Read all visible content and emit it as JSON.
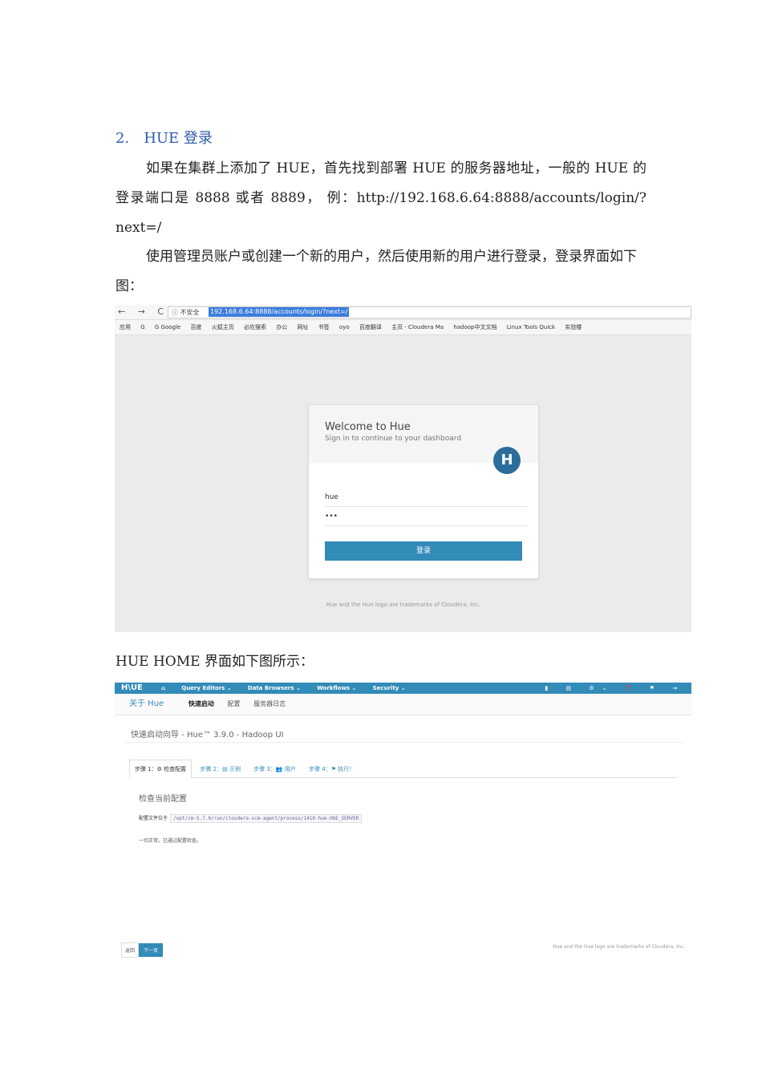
{
  "section": {
    "number": "2.",
    "title": "HUE 登录"
  },
  "paragraphs": {
    "p1": "如果在集群上添加了 HUE，首先找到部署 HUE 的服务器地址，一般的 HUE 的登录端口是 8888 或者 8889， 例：http://192.168.6.64:8888/accounts/login/?next=/",
    "p2": "使用管理员账户或创建一个新的用户，然后使用新的用户进行登录，登录界面如下图：",
    "p3": "HUE HOME 界面如下图所示："
  },
  "login_shot": {
    "nav": "← → C ⌂",
    "insecure": "ⓘ 不安全",
    "url": "192.168.6.64:8888/accounts/login/?next=/",
    "bookmarks": [
      "应用",
      "G",
      "G Google",
      "百度",
      "火狐主页",
      "必应搜索",
      "办公",
      "网址",
      "书签",
      "oyo",
      "百度翻译",
      "主页 - Cloudera Ma",
      "hadoop中文文档",
      "Linux Tools Quick",
      "实验楼"
    ],
    "title": "Welcome to Hue",
    "subtitle": "Sign in to continue to your dashboard",
    "logo": "H",
    "username": "hue",
    "password": "•••",
    "button": "登录",
    "footer": "Hue and the Hue logo are trademarks of Cloudera, Inc."
  },
  "home_shot": {
    "brand": "H\\UE",
    "menus": [
      "⌂",
      "Query Editors ⌄",
      "Data Browsers ⌄",
      "Workflows ⌄",
      "Security ⌄"
    ],
    "right_icons": "▮ ▤ ⚙⌄ ❓ ⚑ ⇥",
    "about": "关于 Hue",
    "tabs": [
      "快速启动",
      "配置",
      "服务器日志"
    ],
    "page_title": "快速启动向导 - Hue™ 3.9.0 - Hadoop UI",
    "steps": [
      "步骤 1：⚙ 检查配置",
      "步骤 2：▤ 示例",
      "步骤 3：👥 用户",
      "步骤 4：⚑ 执行！"
    ],
    "check_heading": "检查当前配置",
    "config_label": "配置文件位于",
    "config_path": "/opt/cm-5.7.0/run/cloudera-scm-agent/process/1410-hue-HUE_SERVER",
    "ok_text": "一切正常。已通过配置检查。",
    "back": "返回",
    "next": "下一页",
    "footer": "Hue and the Hue logo are trademarks of Cloudera, Inc."
  }
}
